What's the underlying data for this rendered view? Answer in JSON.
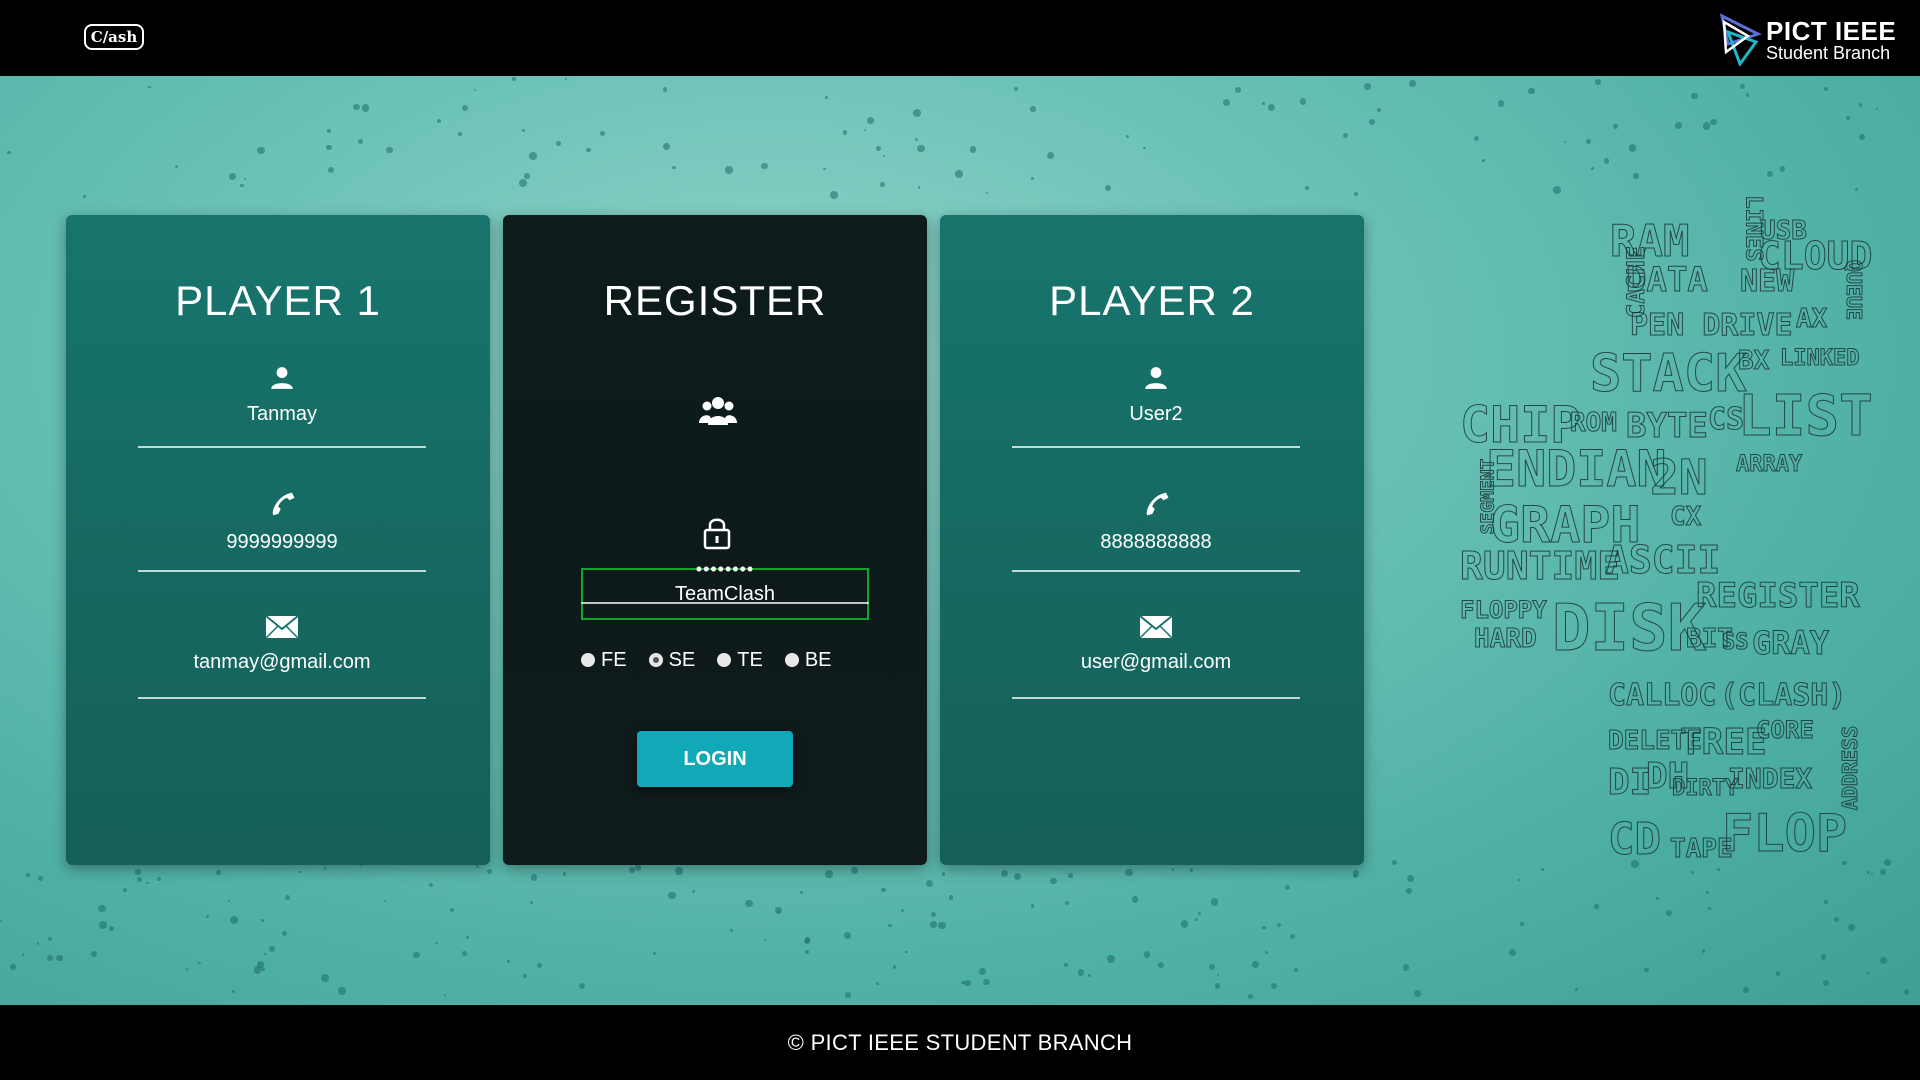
{
  "header": {
    "clash_logo_text": "C/ash",
    "ieee_title": "PICT IEEE",
    "ieee_subtitle": "Student Branch"
  },
  "player1": {
    "title": "PLAYER 1",
    "name": "Tanmay",
    "phone": "9999999999",
    "email": "tanmay@gmail.com"
  },
  "register": {
    "title": "REGISTER",
    "team_name": "TeamClash",
    "password": "••••••••",
    "years": [
      {
        "label": "FE",
        "checked": false
      },
      {
        "label": "SE",
        "checked": true
      },
      {
        "label": "TE",
        "checked": false
      },
      {
        "label": "BE",
        "checked": false
      }
    ],
    "login_label": "LOGIN"
  },
  "player2": {
    "title": "PLAYER 2",
    "name": "User2",
    "phone": "8888888888",
    "email": "user@gmail.com"
  },
  "word_cloud": {
    "words": [
      "RAM",
      "LINES",
      "USB",
      "CLOUD",
      "CACHE",
      "DATA",
      "NEW",
      "QUEUE",
      "PEN DRIVE",
      "AX",
      "STACK",
      "BX",
      "LINKED",
      "CHIP",
      "ROM",
      "BYTE",
      "CS",
      "LIST",
      "ARRAY",
      "SEGMENT",
      "ENDIAN",
      "2N",
      "GRAPH",
      "CX",
      "RUNTIME",
      "ASCII",
      "FLOPPY",
      "HARD",
      "DISK",
      "REGISTER",
      "BIT",
      "SS",
      "GRAY",
      "CALLOC",
      "(CLASH)",
      "DELETE",
      "TREE",
      "CORE",
      "DI",
      "DH",
      "DIRTY",
      "INDEX",
      "ADDRESS",
      "CD",
      "TAPE",
      "FLOP"
    ]
  },
  "footer": {
    "text": "© PICT IEEE STUDENT BRANCH"
  },
  "colors": {
    "teal_card": "#17756d",
    "dark_card": "#0e1b1b",
    "login_button": "#11a8b8",
    "team_box_border": "#12a52e"
  }
}
